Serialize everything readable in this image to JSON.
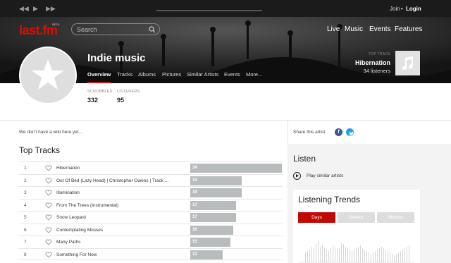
{
  "player": {
    "join_label": "Join",
    "separator": "•",
    "login_label": "Login"
  },
  "header": {
    "logo_text": "last.fm",
    "logo_badge": "BETA",
    "search": {
      "placeholder": "Search"
    },
    "nav": [
      "Live",
      "Music",
      "Events",
      "Features"
    ]
  },
  "tag": {
    "title": "Indie music",
    "tabs": [
      "Overview",
      "Tracks",
      "Albums",
      "Pictures",
      "Similar Artists",
      "Events",
      "More..."
    ],
    "active_tab": "Overview"
  },
  "top_track": {
    "label": "TOP TRACK",
    "name": "Hibernation",
    "listeners": "34 listeners"
  },
  "stats": [
    {
      "label": "SCROBBLES",
      "value": "332"
    },
    {
      "label": "LISTENERS",
      "value": "95"
    }
  ],
  "wiki_text": "We don't have a wiki here yet...",
  "top_tracks": {
    "title": "Top Tracks",
    "max_count": 34,
    "rows": [
      {
        "num": "1",
        "name": "Hibernation",
        "count": 34
      },
      {
        "num": "2",
        "name": "Out Of Bed (Lazy Head) | Christopher Owens | Track ...",
        "count": 19
      },
      {
        "num": "3",
        "name": "Illumination",
        "count": 19
      },
      {
        "num": "4",
        "name": "From The Trees (Instrumental)",
        "count": 17
      },
      {
        "num": "5",
        "name": "Snow Leopard",
        "count": 17
      },
      {
        "num": "6",
        "name": "Contemplating Mosses",
        "count": 16
      },
      {
        "num": "7",
        "name": "Many Paths",
        "count": 15
      },
      {
        "num": "8",
        "name": "Something For Now",
        "count": 12
      }
    ]
  },
  "share": {
    "label": "Share this artist:",
    "facebook_glyph": "f"
  },
  "listen": {
    "title": "Listen",
    "play_label": "Play similar artists"
  },
  "trends": {
    "title": "Listening Trends",
    "buttons": [
      "Days",
      "Weeks",
      "Months"
    ],
    "active": "Days"
  },
  "colors": {
    "brand_red": "#d51007",
    "bar_grey": "#b9bcbc",
    "facebook": "#3b5998",
    "twitter": "#1da1f2"
  }
}
